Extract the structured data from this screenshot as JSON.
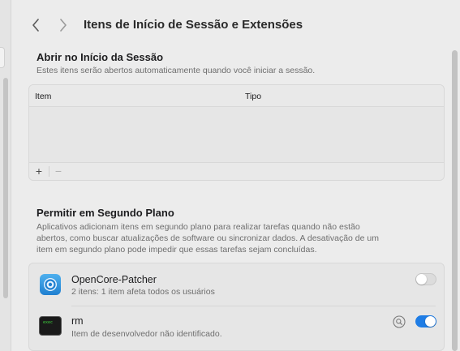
{
  "header": {
    "title": "Itens de Início de Sessão e Extensões",
    "back_icon": "chevron-left-icon",
    "forward_icon": "chevron-right-icon"
  },
  "login_items": {
    "title": "Abrir no Início da Sessão",
    "description": "Estes itens serão abertos automaticamente quando você iniciar a sessão.",
    "columns": [
      "Item",
      "Tipo"
    ],
    "rows": [],
    "add_label": "+",
    "remove_label": "−"
  },
  "background": {
    "title": "Permitir em Segundo Plano",
    "description_lines": [
      "Aplicativos adicionam itens em segundo plano para realizar tarefas quando não estão",
      "abertos, como buscar atualizações de software ou sincronizar dados. A desativação de um",
      "item em segundo plano pode impedir que essas tarefas sejam concluídas."
    ],
    "items": [
      {
        "name": "OpenCore-Patcher",
        "subtitle": "2 itens: 1 item afeta todos os usuários",
        "icon": "opencore-patcher-app-icon",
        "enabled": false
      },
      {
        "name": "rm",
        "subtitle": "Item de desenvolvedor não identificado.",
        "icon": "terminal-exec-icon",
        "icon_text": "exec",
        "enabled": true
      }
    ]
  },
  "colors": {
    "accent": "#1f7de5",
    "background": "#ececec",
    "panel": "#e6e6e6"
  }
}
